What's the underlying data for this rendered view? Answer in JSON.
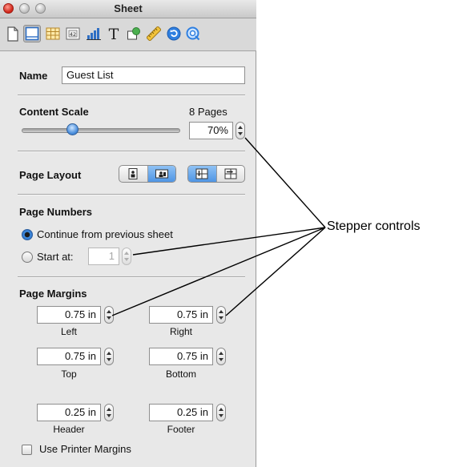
{
  "window": {
    "title": "Sheet"
  },
  "toolbar": {
    "icons": [
      "document-icon",
      "sheet-icon",
      "table-icon",
      "cell-format-icon",
      "chart-icon",
      "text-icon",
      "graphic-icon",
      "metrics-icon",
      "hyperlink-icon",
      "quicktime-icon"
    ],
    "selected": "sheet-icon"
  },
  "name": {
    "label": "Name",
    "value": "Guest List"
  },
  "content_scale": {
    "label": "Content Scale",
    "pages": "8 Pages",
    "value": "70%",
    "slider_fraction": 0.31
  },
  "page_layout": {
    "label": "Page Layout",
    "orientation_selected": "landscape",
    "order_selected": "top-to-bottom"
  },
  "page_numbers": {
    "label": "Page Numbers",
    "continue_label": "Continue from previous sheet",
    "start_label": "Start at:",
    "start_value": "1",
    "selected": "continue"
  },
  "page_margins": {
    "label": "Page Margins",
    "left": {
      "value": "0.75 in",
      "label": "Left"
    },
    "right": {
      "value": "0.75 in",
      "label": "Right"
    },
    "top": {
      "value": "0.75 in",
      "label": "Top"
    },
    "bottom": {
      "value": "0.75 in",
      "label": "Bottom"
    },
    "header": {
      "value": "0.25 in",
      "label": "Header"
    },
    "footer": {
      "value": "0.25 in",
      "label": "Footer"
    }
  },
  "use_printer_margins": {
    "label": "Use Printer Margins",
    "checked": false
  },
  "annotation": {
    "text": "Stepper controls"
  },
  "colors": {
    "accent": "#4f95e4",
    "panel_bg": "#e8e8e8"
  }
}
